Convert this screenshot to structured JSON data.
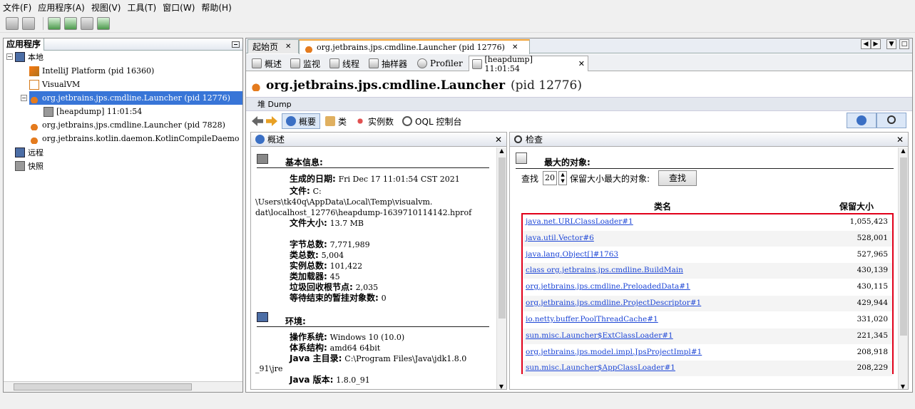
{
  "menu": [
    "文件(F)",
    "应用程序(A)",
    "视图(V)",
    "工具(T)",
    "窗口(W)",
    "帮助(H)"
  ],
  "left_panel": {
    "title": "应用程序",
    "local": "本地",
    "apps": [
      "IntelliJ Platform (pid 16360)",
      "VisualVM",
      "org.jetbrains.jps.cmdline.Launcher (pid 12776)",
      "[heapdump] 11:01:54",
      "org.jetbrains.jps.cmdline.Launcher (pid 7828)",
      "org.jetbrains.kotlin.daemon.KotlinCompileDaemo"
    ],
    "remote": "远程",
    "snapshots": "快照"
  },
  "tabs": {
    "start": "起始页",
    "launcher": "org.jetbrains.jps.cmdline.Launcher (pid 12776)"
  },
  "subtabs": [
    "概述",
    "监视",
    "线程",
    "抽样器",
    "Profiler",
    "[heapdump] 11:01:54"
  ],
  "header": {
    "title": "org.jetbrains.jps.cmdline.Launcher",
    "pid": "(pid 12776)",
    "dump_label": "堆 Dump"
  },
  "views": {
    "summary": "概要",
    "classes": "类",
    "instances": "实例数",
    "oql": "OQL 控制台"
  },
  "overview": {
    "title": "概述",
    "basic_title": "基本信息:",
    "generated_label": "生成的日期:",
    "generated_value": "Fri Dec 17 11:01:54 CST 2021",
    "file_label": "文件:",
    "file_value_1": "C:",
    "file_value_2": "\\Users\\tk40q\\AppData\\Local\\Temp\\visualvm.",
    "file_value_3": "dat\\localhost_12776\\heapdump-1639710114142.hprof",
    "filesize_label": "文件大小:",
    "filesize_value": "13.7 MB",
    "bytes_label": "字节总数:",
    "bytes_value": "7,771,989",
    "classes_label": "类总数:",
    "classes_value": "5,004",
    "instances_label": "实例总数:",
    "instances_value": "101,422",
    "loaders_label": "类加载器:",
    "loaders_value": "45",
    "gcroots_label": "垃圾回收根节点:",
    "gcroots_value": "2,035",
    "pending_label": "等待结束的暂挂对象数:",
    "pending_value": "0",
    "env_title": "环境:",
    "os_label": "操作系统:",
    "os_value": "Windows 10 (10.0)",
    "arch_label": "体系结构:",
    "arch_value": "amd64 64bit",
    "javahome_label": "Java 主目录:",
    "javahome_value": "C:\\Program Files\\Java\\jdk1.8.0",
    "javahome_value_2": "_91\\jre",
    "javaver_label": "Java 版本:",
    "javaver_value": "1.8.0_91"
  },
  "inspect": {
    "title": "检查",
    "biggest_title": "最大的对象:",
    "find_label": "查找",
    "find_count": "20",
    "find_suffix": "保留大小最大的对象:",
    "find_button": "查找",
    "col_class": "类名",
    "col_size": "保留大小",
    "rows": [
      {
        "name": "java.net.URLClassLoader#1",
        "size": "1,055,423"
      },
      {
        "name": "java.util.Vector#6",
        "size": "528,001"
      },
      {
        "name": "java.lang.Object[]#1763",
        "size": "527,965"
      },
      {
        "name": "class org.jetbrains.jps.cmdline.BuildMain",
        "size": "430,139"
      },
      {
        "name": "org.jetbrains.jps.cmdline.PreloadedData#1",
        "size": "430,115"
      },
      {
        "name": "org.jetbrains.jps.cmdline.ProjectDescriptor#1",
        "size": "429,944"
      },
      {
        "name": "io.netty.buffer.PoolThreadCache#1",
        "size": "331,020"
      },
      {
        "name": "sun.misc.Launcher$ExtClassLoader#1",
        "size": "221,345"
      },
      {
        "name": "org.jetbrains.jps.model.impl.JpsProjectImpl#1",
        "size": "208,918"
      },
      {
        "name": "sun.misc.Launcher$AppClassLoader#1",
        "size": "208,229"
      }
    ]
  },
  "colors": {
    "selection": "#3875d7",
    "highlight_border": "#e1001a",
    "link": "#1d46d6"
  }
}
